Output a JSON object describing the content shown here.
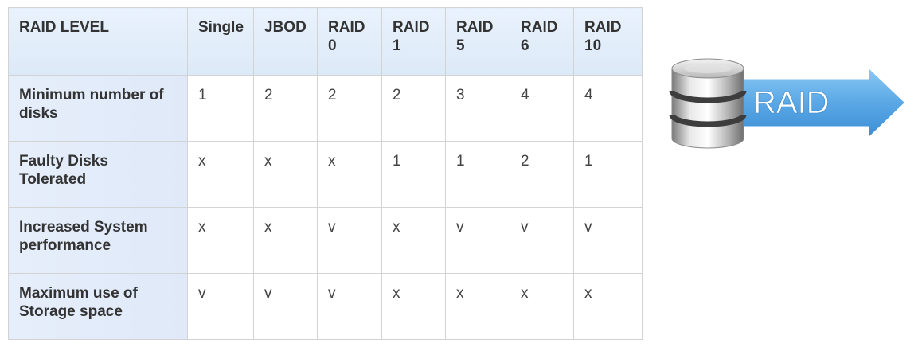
{
  "table": {
    "header": [
      "RAID LEVEL",
      "Single",
      "JBOD",
      "RAID 0",
      "RAID 1",
      "RAID 5",
      "RAID 6",
      "RAID 10"
    ],
    "rows": [
      {
        "label": "Minimum number of disks",
        "values": [
          "1",
          "2",
          "2",
          "2",
          "3",
          "4",
          "4"
        ]
      },
      {
        "label": "Faulty Disks Tolerated",
        "values": [
          "x",
          "x",
          "x",
          "1",
          "1",
          "2",
          "1"
        ]
      },
      {
        "label": "Increased System performance",
        "values": [
          "x",
          "x",
          "v",
          "x",
          "v",
          "v",
          "v"
        ]
      },
      {
        "label": "Maximum use of Storage space",
        "values": [
          "v",
          "v",
          "v",
          "x",
          "x",
          "x",
          "x"
        ]
      }
    ]
  },
  "logo": {
    "text": "RAID",
    "icon": "database-icon",
    "arrow_color": "#5aa8e6"
  }
}
